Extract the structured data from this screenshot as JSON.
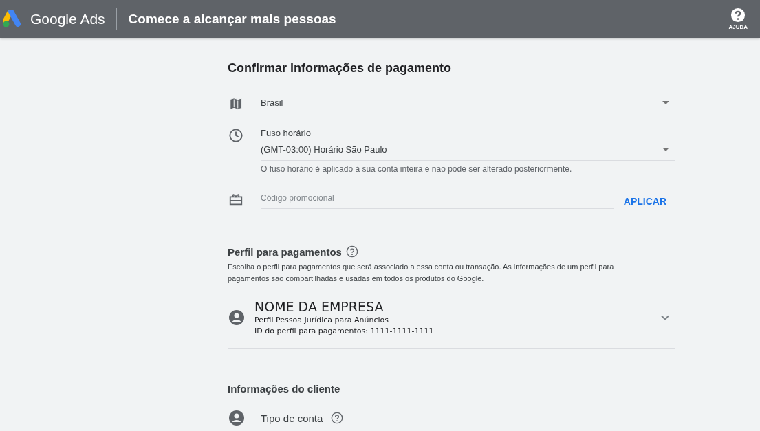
{
  "header": {
    "brand": "Google Ads",
    "title": "Comece a alcançar mais pessoas",
    "help_label": "AJUDA"
  },
  "payment": {
    "title": "Confirmar informações de pagamento",
    "country": {
      "value": "Brasil"
    },
    "timezone": {
      "label": "Fuso horário",
      "value": "(GMT-03:00) Horário São Paulo",
      "hint": "O fuso horário é aplicado à sua conta inteira e não pode ser alterado posteriormente."
    },
    "promo": {
      "placeholder": "Código promocional",
      "button": "APLICAR"
    }
  },
  "profile": {
    "title": "Perfil para pagamentos",
    "description": "Escolha o perfil para pagamentos que será associado a essa conta ou transação. As informações de um perfil para pagamentos são compartilhadas e usadas em todos os produtos do Google.",
    "name": "NOME DA EMPRESA",
    "type": "Perfil Pessoa Jurídica para Anúncios",
    "id_line": "ID do perfil para pagamentos: 1111-1111-1111",
    "expanded": false
  },
  "client": {
    "title": "Informações do cliente",
    "account_type_label": "Tipo de conta"
  }
}
